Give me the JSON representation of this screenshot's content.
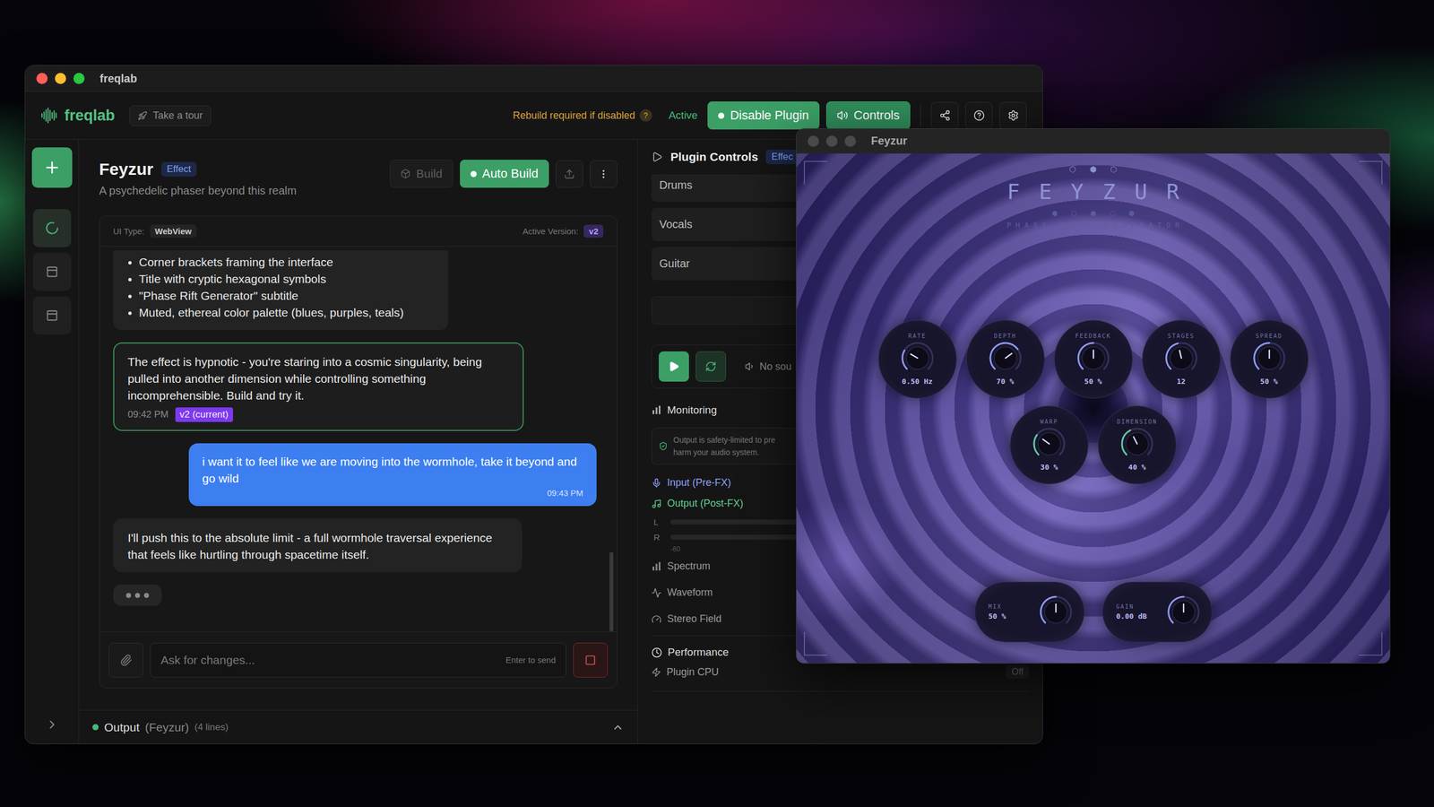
{
  "main_window": {
    "title": "freqlab",
    "header": {
      "brand": "freqlab",
      "tour_button": "Take a tour",
      "rebuild_notice": "Rebuild required if disabled",
      "rebuild_help": "?",
      "status": "Active",
      "disable_button": "Disable Plugin",
      "controls_button": {
        "label": "Controls",
        "selected": true
      }
    },
    "rail": {
      "items": [
        {
          "kind": "spinner",
          "selected": true
        },
        {
          "kind": "plugin",
          "selected": false
        },
        {
          "kind": "plugin",
          "selected": false
        }
      ],
      "expanded": false
    },
    "project": {
      "name": "Feyzur",
      "type": "Effect",
      "description": "A psychedelic phaser beyond this realm",
      "build_button": {
        "label": "Build",
        "disabled": true
      },
      "auto_build_button": {
        "label": "Auto Build",
        "on": true
      }
    },
    "chat": {
      "ui_type_label": "UI Type:",
      "ui_type": "WebView",
      "version_label": "Active Version:",
      "version": "v2",
      "messages": [
        {
          "role": "assistant",
          "kind": "list",
          "selected": false,
          "items": [
            "Corner brackets framing the interface",
            "Title with cryptic hexagonal symbols",
            "\"Phase Rift Generator\" subtitle",
            "Muted, ethereal color palette (blues, purples, teals)"
          ]
        },
        {
          "role": "assistant",
          "kind": "text",
          "selected": true,
          "text": "The effect is hypnotic - you're staring into a cosmic singularity, being pulled into another dimension while controlling something incomprehensible. Build and try it.",
          "time": "09:42 PM",
          "version": "v2 (current)"
        },
        {
          "role": "user",
          "kind": "text",
          "selected": false,
          "text": "i want it to feel like we are moving into the wormhole, take it beyond and go wild",
          "time": "09:43 PM"
        },
        {
          "role": "assistant",
          "kind": "text",
          "selected": false,
          "text": "I'll push this to the absolute limit - a full wormhole traversal experience that feels like hurtling through spacetime itself."
        },
        {
          "role": "assistant",
          "kind": "typing",
          "selected": false
        }
      ],
      "input": {
        "placeholder": "Ask for changes...",
        "hint": "Enter to send"
      }
    },
    "output_bar": {
      "label": "Output",
      "target": "(Feyzur)",
      "count": "(4 lines)",
      "expanded": false
    },
    "plugin_controls": {
      "title": "Plugin Controls",
      "badge": "Effec",
      "samples": [
        {
          "label": "Drums",
          "selected": false
        },
        {
          "label": "Vocals",
          "selected": false
        },
        {
          "label": "Guitar",
          "selected": false
        }
      ],
      "transport": {
        "playing": false,
        "loop": true,
        "source": "No sou"
      },
      "monitoring": {
        "title": "Monitoring",
        "notice_lines": [
          "Output is safety-limited to pre",
          "harm your audio system."
        ],
        "input": "Input (Pre-FX)",
        "output": "Output (Post-FX)",
        "meters": [
          {
            "channel": "L",
            "level": 0
          },
          {
            "channel": "R",
            "level": 0
          }
        ],
        "scale": "-60",
        "views": [
          {
            "label": "Spectrum",
            "kind": "spectrum"
          },
          {
            "label": "Waveform",
            "kind": "waveform"
          },
          {
            "label": "Stereo Field",
            "kind": "stereo"
          }
        ]
      },
      "performance": {
        "title": "Performance",
        "expanded": true,
        "rows": [
          {
            "label": "Plugin CPU",
            "value": "Off"
          }
        ]
      }
    }
  },
  "plugin_window": {
    "title": "Feyzur",
    "symbols_top": "⬡ ⬢ ⬡",
    "name": "FEYZUR",
    "symbols_bottom": "⬢ ⬡ ⬢ ⬡ ⬢",
    "subtitle": "PHASE RIFT GENERATOR",
    "knob_rows": [
      [
        {
          "label": "RATE",
          "value": "0.50 Hz",
          "level": 0.28,
          "color": "#8e9af0"
        },
        {
          "label": "DEPTH",
          "value": "70 %",
          "level": 0.7,
          "color": "#8e9af0"
        },
        {
          "label": "FEEDBACK",
          "value": "50 %",
          "level": 0.5,
          "color": "#8e9af0"
        },
        {
          "label": "STAGES",
          "value": "12",
          "level": 0.45,
          "color": "#8e9af0"
        },
        {
          "label": "SPREAD",
          "value": "50 %",
          "level": 0.5,
          "color": "#8e9af0"
        }
      ],
      [
        {
          "label": "WARP",
          "value": "30 %",
          "level": 0.3,
          "color": "#62c9a0"
        },
        {
          "label": "DIMENSION",
          "value": "40 %",
          "level": 0.4,
          "color": "#62c9a0"
        }
      ]
    ],
    "bottom_knobs": [
      {
        "label": "MIX",
        "value": "50 %",
        "level": 0.5,
        "color": "#8e9af0"
      },
      {
        "label": "GAIN",
        "value": "0.00 dB",
        "level": 0.5,
        "color": "#8e9af0"
      }
    ]
  }
}
